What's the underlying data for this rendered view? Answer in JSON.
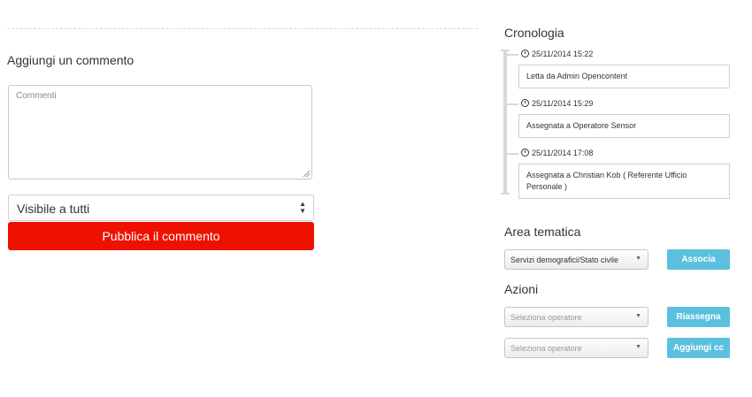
{
  "comment_form": {
    "title": "Aggiungi un commento",
    "placeholder": "Commenti",
    "visibility_value": "Visibile a tutti",
    "submit_label": "Pubblica il commento"
  },
  "timeline": {
    "title": "Cronologia",
    "events": [
      {
        "date": "25/11/2014 15:22",
        "text": "Letta da Admin Opencontent"
      },
      {
        "date": "25/11/2014 15:29",
        "text": "Assegnata a Operatore Sensor"
      },
      {
        "date": "25/11/2014 17:08",
        "text": "Assegnata a Christian Kob ( Referente Ufficio Personale )"
      }
    ]
  },
  "area_tematica": {
    "title": "Area tematica",
    "selected": "Servizi demografici/Stato civile",
    "button_label": "Associa"
  },
  "azioni": {
    "title": "Azioni",
    "reassign": {
      "placeholder": "Seleziona operatore",
      "button_label": "Riassegna"
    },
    "add_cc": {
      "placeholder": "Seleziona operatore",
      "button_label": "Aggiungi cc"
    }
  },
  "colors": {
    "primary_red": "#ee1100",
    "info_blue": "#5bc0de"
  }
}
